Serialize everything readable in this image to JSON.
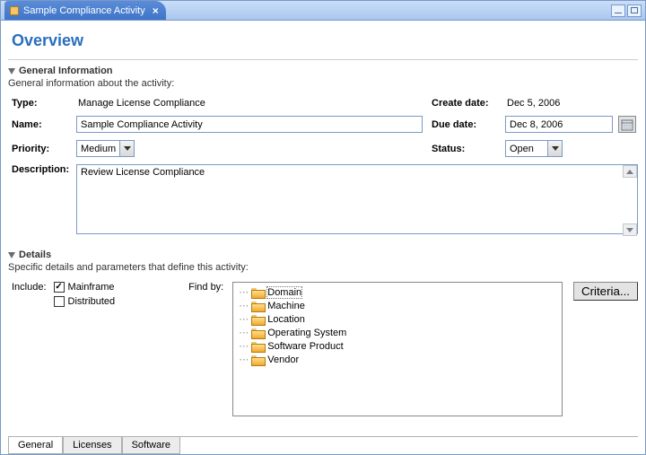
{
  "title_tab": "Sample Compliance Activity",
  "page_title": "Overview",
  "sections": {
    "general": {
      "heading": "General Information",
      "sub": "General information about the activity:",
      "type_label": "Type:",
      "type_value": "Manage License Compliance",
      "name_label": "Name:",
      "name_value": "Sample Compliance Activity",
      "priority_label": "Priority:",
      "priority_value": "Medium",
      "description_label": "Description:",
      "description_value": "Review License Compliance",
      "create_date_label": "Create date:",
      "create_date_value": "Dec 5, 2006",
      "due_date_label": "Due date:",
      "due_date_value": "Dec 8, 2006",
      "status_label": "Status:",
      "status_value": "Open"
    },
    "details": {
      "heading": "Details",
      "sub": "Specific details and parameters that define this activity:",
      "include_label": "Include:",
      "include_mainframe": "Mainframe",
      "include_distributed": "Distributed",
      "findby_label": "Find by:",
      "tree": {
        "domain": "Domain",
        "machine": "Machine",
        "location": "Location",
        "os": "Operating System",
        "sw": "Software Product",
        "vendor": "Vendor"
      },
      "criteria_btn": "Criteria..."
    }
  },
  "bottom_tabs": {
    "general": "General",
    "licenses": "Licenses",
    "software": "Software"
  }
}
